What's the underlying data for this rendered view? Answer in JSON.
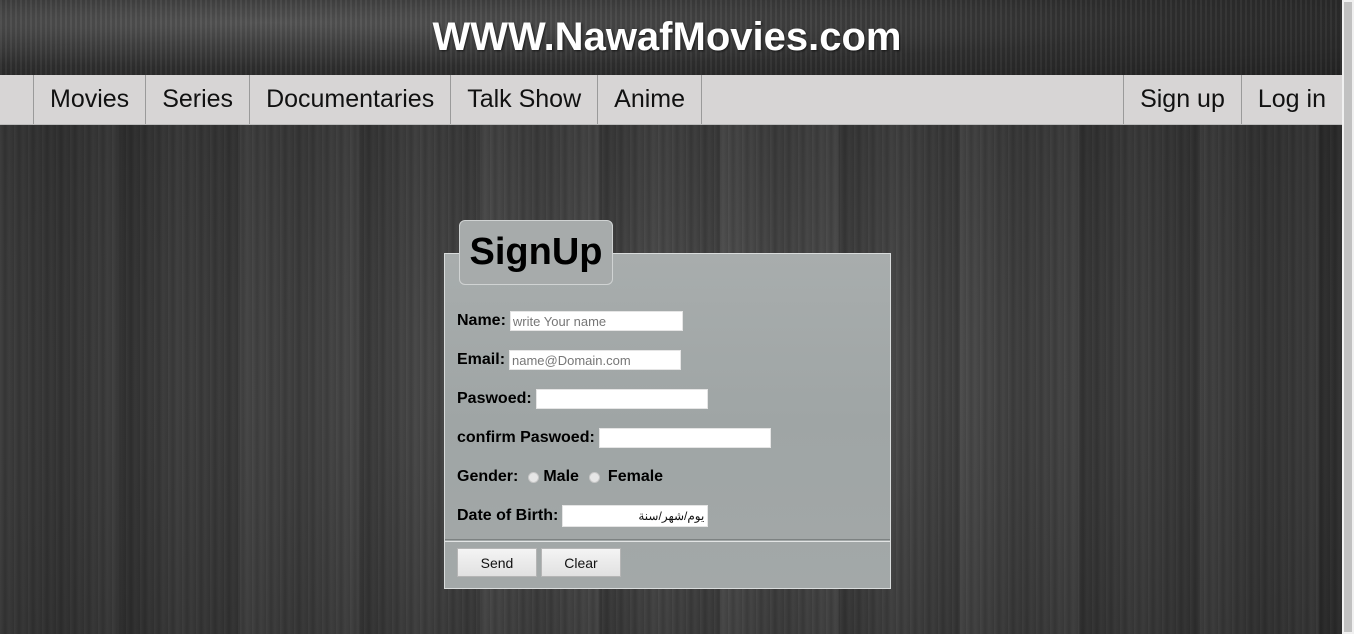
{
  "site": {
    "title": "WWW.NawafMovies.com"
  },
  "nav": {
    "left": [
      "Movies",
      "Series",
      "Documentaries",
      "Talk Show",
      "Anime"
    ],
    "right": [
      "Sign up",
      "Log in"
    ]
  },
  "form": {
    "legend": "SignUp",
    "name": {
      "label": "Name:",
      "placeholder": "write Your name"
    },
    "email": {
      "label": "Email:",
      "placeholder": "name@Domain.com"
    },
    "password": {
      "label": "Paswoed:"
    },
    "confirm": {
      "label": "confirm Paswoed:"
    },
    "gender": {
      "label": "Gender:",
      "options": [
        "Male",
        "Female"
      ]
    },
    "dob": {
      "label": "Date of Birth:",
      "placeholder": "يوم/شهر/سنة"
    },
    "buttons": {
      "send": "Send",
      "clear": "Clear"
    }
  },
  "colors": {
    "navbar": "#d7d5d5",
    "form_panel": "#a4a9a9",
    "title_text": "#ffffff"
  },
  "icons": [
    "radio-icon"
  ]
}
